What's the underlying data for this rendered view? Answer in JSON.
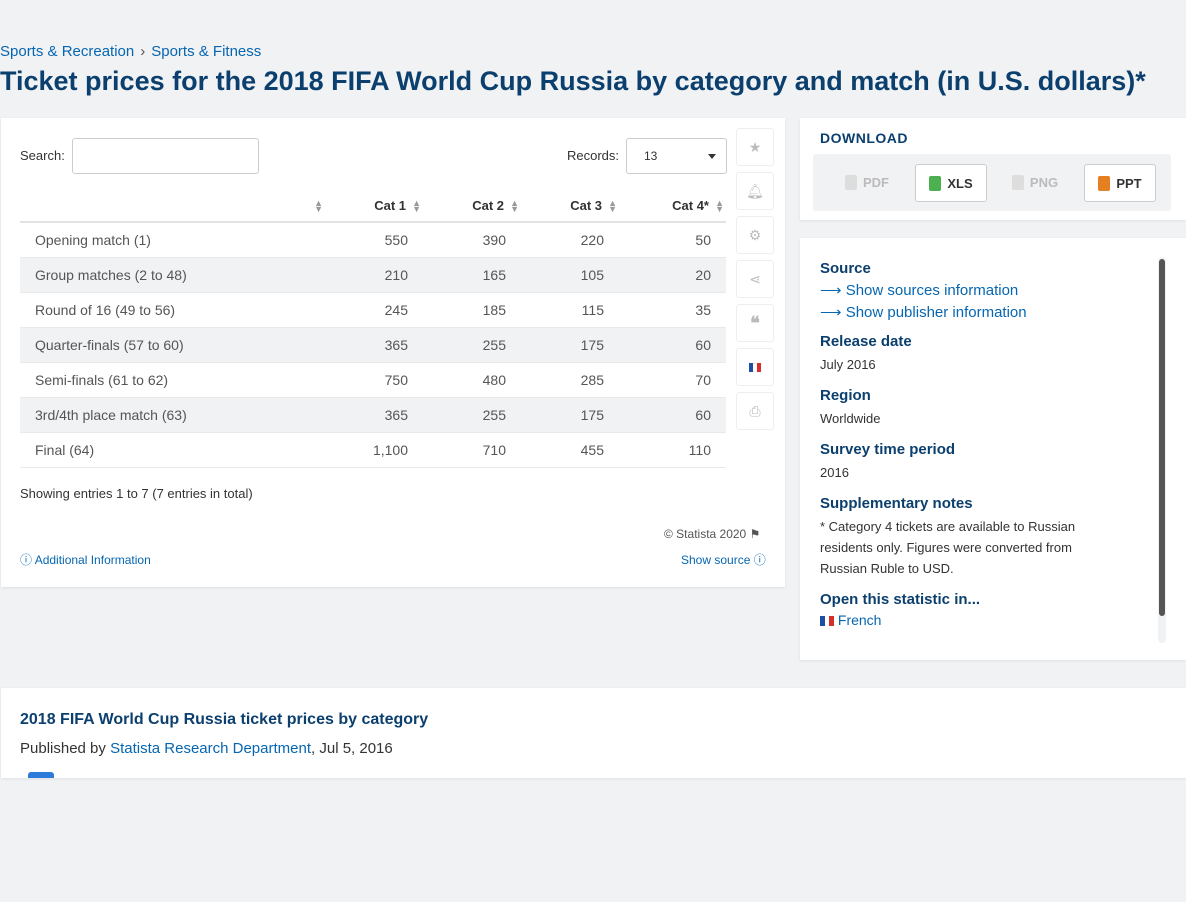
{
  "breadcrumb": [
    "Sports & Recreation",
    "Sports & Fitness"
  ],
  "breadcrumb_sep": "›",
  "title": "Ticket prices for the 2018 FIFA World Cup Russia by category and match (in U.S. dollars)*",
  "search": {
    "label": "Search:",
    "value": ""
  },
  "records": {
    "label": "Records:",
    "value": "13"
  },
  "table": {
    "headers": [
      "",
      "Cat 1",
      "Cat 2",
      "Cat 3",
      "Cat 4*"
    ],
    "rows": [
      [
        "Opening match (1)",
        "550",
        "390",
        "220",
        "50"
      ],
      [
        "Group matches (2 to 48)",
        "210",
        "165",
        "105",
        "20"
      ],
      [
        "Round of 16 (49 to 56)",
        "245",
        "185",
        "115",
        "35"
      ],
      [
        "Quarter-finals (57 to 60)",
        "365",
        "255",
        "175",
        "60"
      ],
      [
        "Semi-finals (61 to 62)",
        "750",
        "480",
        "285",
        "70"
      ],
      [
        "3rd/4th place match (63)",
        "365",
        "255",
        "175",
        "60"
      ],
      [
        "Final (64)",
        "1,100",
        "710",
        "455",
        "110"
      ]
    ]
  },
  "showing": "Showing entries 1 to 7 (7 entries in total)",
  "copyright": "© Statista 2020",
  "additional": "Additional Information",
  "show_source": "Show source",
  "download": {
    "title": "DOWNLOAD",
    "buttons": [
      {
        "label": "PDF",
        "enabled": false,
        "color": "#bbbbbb"
      },
      {
        "label": "XLS",
        "enabled": true,
        "color": "#4caf50"
      },
      {
        "label": "PNG",
        "enabled": false,
        "color": "#bbbbbb"
      },
      {
        "label": "PPT",
        "enabled": true,
        "color": "#e67e22"
      }
    ]
  },
  "info": {
    "source_h": "Source",
    "show_sources": "Show sources information",
    "show_publisher": "Show publisher information",
    "release_h": "Release date",
    "release": "July 2016",
    "region_h": "Region",
    "region": "Worldwide",
    "survey_h": "Survey time period",
    "survey": "2016",
    "notes_h": "Supplementary notes",
    "notes": "* Category 4 tickets are available to Russian residents only. Figures were converted from Russian Ruble to USD.",
    "open_h": "Open this statistic in...",
    "open_lang": "French"
  },
  "bottom": {
    "title": "2018 FIFA World Cup Russia ticket prices by category",
    "published_prefix": "Published by",
    "publisher": "Statista Research Department",
    "date": ", Jul 5, 2016"
  },
  "colors": {
    "title": "#0b3f6e",
    "link": "#0666b1",
    "stripe": "#f1f2f4"
  }
}
